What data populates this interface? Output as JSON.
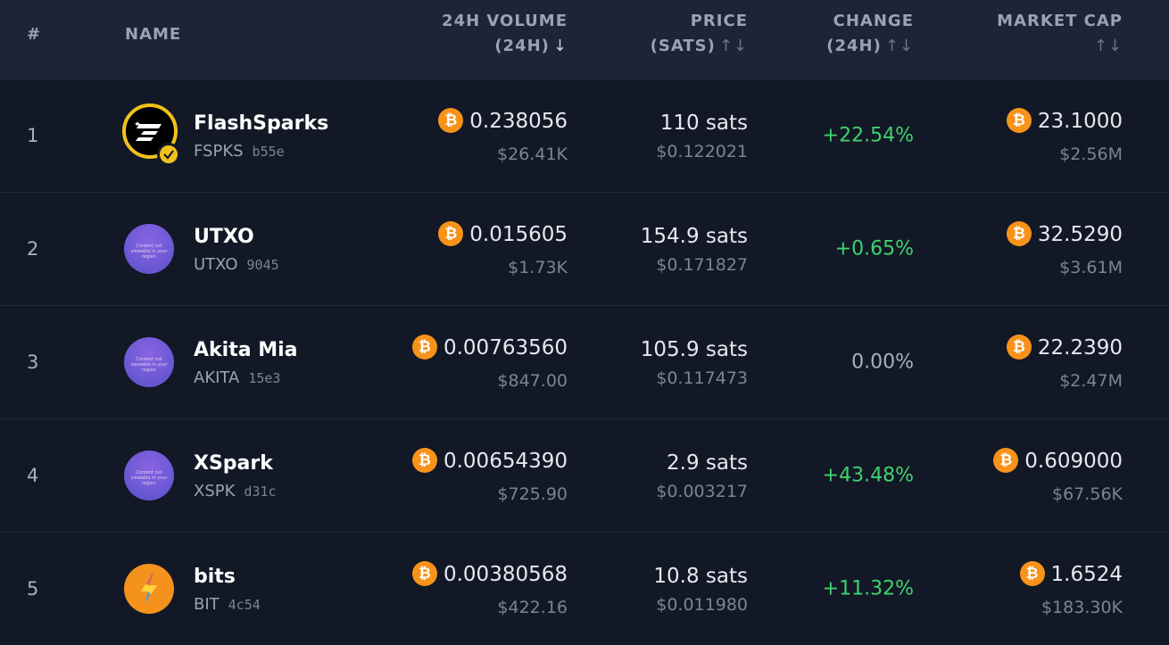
{
  "header": {
    "rank": "#",
    "name": "NAME",
    "volume_line1": "24H VOLUME",
    "volume_line2": "(24H)",
    "volume_sort": "↓",
    "price_line1": "PRICE",
    "price_line2": "(SATS)",
    "price_sort": "↑↓",
    "change_line1": "CHANGE",
    "change_line2": "(24H)",
    "change_sort": "↑↓",
    "mcap_line1": "MARKET CAP",
    "mcap_sort": "↑↓"
  },
  "avatar_text": "Content not viewable in your region",
  "btc_symbol": "₿",
  "colors": {
    "background": "#121826",
    "header_background": "#1c2435",
    "positive": "#3ed36e",
    "bitcoin": "#f7931a",
    "verified_badge": "#f2c21a"
  },
  "rows": [
    {
      "rank": "1",
      "name": "FlashSparks",
      "symbol": "FSPKS",
      "id": "b55e",
      "avatar": "flashsparks-logo",
      "verified": true,
      "volume_btc": "0.238056",
      "volume_usd": "$26.41K",
      "price_sats": "110 sats",
      "price_usd": "$0.122021",
      "change": "+22.54%",
      "mcap_btc": "23.1000",
      "mcap_usd": "$2.56M"
    },
    {
      "rank": "2",
      "name": "UTXO",
      "symbol": "UTXO",
      "id": "9045",
      "avatar": "content-not-viewable",
      "volume_btc": "0.015605",
      "volume_usd": "$1.73K",
      "price_sats": "154.9 sats",
      "price_usd": "$0.171827",
      "change": "+0.65%",
      "mcap_btc": "32.5290",
      "mcap_usd": "$3.61M"
    },
    {
      "rank": "3",
      "name": "Akita Mia",
      "symbol": "AKITA",
      "id": "15e3",
      "avatar": "content-not-viewable",
      "volume_btc": "0.00763560",
      "volume_usd": "$847.00",
      "price_sats": "105.9 sats",
      "price_usd": "$0.117473",
      "change": "0.00%",
      "mcap_btc": "22.2390",
      "mcap_usd": "$2.47M"
    },
    {
      "rank": "4",
      "name": "XSpark",
      "symbol": "XSPK",
      "id": "d31c",
      "avatar": "content-not-viewable",
      "volume_btc": "0.00654390",
      "volume_usd": "$725.90",
      "price_sats": "2.9 sats",
      "price_usd": "$0.003217",
      "change": "+43.48%",
      "mcap_btc": "0.609000",
      "mcap_usd": "$67.56K"
    },
    {
      "rank": "5",
      "name": "bits",
      "symbol": "BIT",
      "id": "4c54",
      "avatar": "lightning-bolt-logo",
      "volume_btc": "0.00380568",
      "volume_usd": "$422.16",
      "price_sats": "10.8 sats",
      "price_usd": "$0.011980",
      "change": "+11.32%",
      "mcap_btc": "1.6524",
      "mcap_usd": "$183.30K"
    }
  ]
}
